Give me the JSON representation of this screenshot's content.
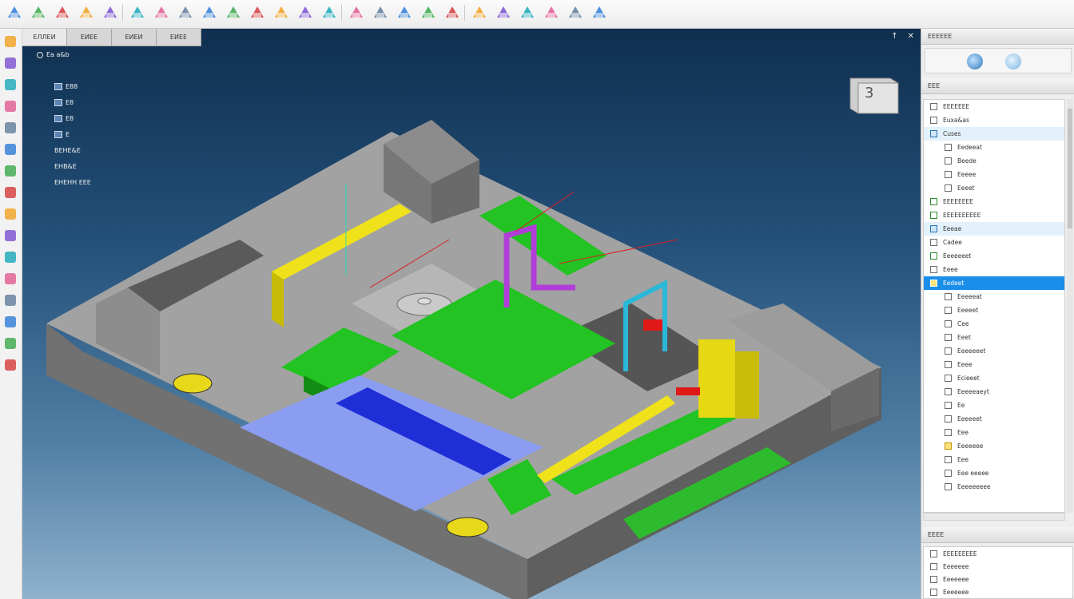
{
  "viewport": {
    "tabs": [
      {
        "label": "ЕЛЛЕИ"
      },
      {
        "label": "ЕИЕЕ"
      },
      {
        "label": "ЕИЕИ"
      },
      {
        "label": "ЕИЕЕ"
      }
    ],
    "controls": [
      "↑",
      "✕"
    ]
  },
  "tree": {
    "items": [
      {
        "label": "Ea a&b"
      },
      {
        "label": "E88"
      },
      {
        "label": "E8"
      },
      {
        "label": "E8"
      },
      {
        "label": "E"
      },
      {
        "label": "BEHE&E"
      },
      {
        "label": "EHB&E"
      },
      {
        "label": "EHEHH EEE"
      }
    ]
  },
  "nav_cube": {
    "face_label": "3"
  },
  "panel": {
    "title": "ЕЕЕЕЕЕ",
    "section_title": "ЕЕЕ",
    "rows": [
      {
        "label": "ЕЕЕЕЕЕЕ"
      },
      {
        "label": "Euxa&as"
      },
      {
        "label": "Cuses"
      },
      {
        "label": "Eedeeat"
      },
      {
        "label": "Beede"
      },
      {
        "label": "Eeeee"
      },
      {
        "label": "Eeeet"
      },
      {
        "label": "EEEEEEEE"
      },
      {
        "label": "EEEEEEEEEE"
      },
      {
        "label": "Eeeae"
      },
      {
        "label": "Cadee"
      },
      {
        "label": "Eeeeeeet"
      },
      {
        "label": "Eeee"
      },
      {
        "label": "Eedeet"
      },
      {
        "label": "Eeeeeat"
      },
      {
        "label": "Eeeeet"
      },
      {
        "label": "Cee"
      },
      {
        "label": "Eeet"
      },
      {
        "label": "Eeeeeeet"
      },
      {
        "label": "Eeee"
      },
      {
        "label": "Ecieeet"
      },
      {
        "label": "Eeeeeaeyt"
      },
      {
        "label": "Ee"
      },
      {
        "label": "Eeeeeet"
      },
      {
        "label": "Eee"
      },
      {
        "label": "Eeeeeee"
      },
      {
        "label": "Eee"
      },
      {
        "label": "Eee eeeee"
      },
      {
        "label": "Eeeeeeeee"
      }
    ],
    "bottom_title": "ЕЕЕЕ",
    "bottom_rows": [
      {
        "label": "EEEEEEEEE"
      },
      {
        "label": "Eeeeeee"
      },
      {
        "label": "Eeeeeee"
      },
      {
        "label": "Eeeeeee"
      }
    ]
  },
  "colors": {
    "accent": "#1a8ee8",
    "model_gray": "#9a9a9a",
    "model_green": "#22c322",
    "model_yellow": "#f0e21a",
    "model_blue": "#1f2fd8",
    "model_water": "#8a9df0",
    "model_purple": "#b13ed8",
    "model_cyan": "#2bb8d8",
    "model_red": "#e01818"
  },
  "icons": [
    "open-icon",
    "download-icon",
    "select-icon",
    "shape-icon",
    "fill-icon",
    "color-icon",
    "fit-icon",
    "rotate-icon",
    "view-icon",
    "pin-icon",
    "cube-icon",
    "measure-icon",
    "section-icon",
    "render-icon",
    "edit-icon",
    "layout-icon",
    "map-icon",
    "dual-icon",
    "assist-icon",
    "snap-icon",
    "image-icon",
    "frame-icon",
    "move-icon",
    "anchor-icon",
    "sync-icon"
  ]
}
